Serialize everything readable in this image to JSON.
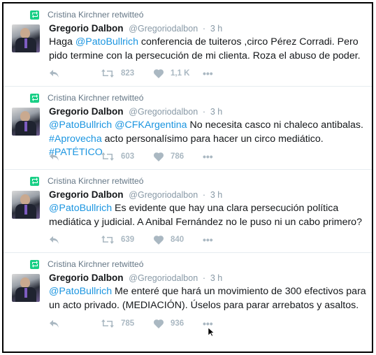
{
  "retweeter": "Cristina Kirchner retwitteó",
  "author": {
    "name": "Gregorio Dalbon",
    "handle": "@Gregoriodalbon",
    "separator": "·"
  },
  "tweets": [
    {
      "time": "3 h",
      "segments": [
        {
          "t": "Haga "
        },
        {
          "t": "@PatoBullrich",
          "link": true
        },
        {
          "t": " conferencia de tuiteros ,circo Pérez Corradi. Pero pido termine con la persecución de mi clienta. Roza el abuso de poder."
        }
      ],
      "retweets": "823",
      "likes": "1,1 K"
    },
    {
      "time": "3 h",
      "segments": [
        {
          "t": "@PatoBullrich",
          "link": true
        },
        {
          "t": " "
        },
        {
          "t": "@CFKArgentina",
          "link": true
        },
        {
          "t": " No necesita casco ni chaleco antibalas. "
        },
        {
          "t": "#Aprovecha",
          "link": true
        },
        {
          "t": " acto personalísimo para hacer un circo mediático. "
        },
        {
          "t": "#PATÉTICO",
          "link": true,
          "break_before": true
        }
      ],
      "retweets": "603",
      "likes": "786"
    },
    {
      "time": "3 h",
      "segments": [
        {
          "t": "@PatoBullrich",
          "link": true
        },
        {
          "t": " Es evidente que hay una clara persecución política mediática y judicial. A Anibal Fernández no le puso ni un cabo primero?"
        }
      ],
      "retweets": "639",
      "likes": "840"
    },
    {
      "time": "3 h",
      "segments": [
        {
          "t": "@PatoBullrich",
          "link": true
        },
        {
          "t": " Me enteré que hará un movimiento de 300 efectivos para un acto privado. (MEDIACIÓN). Úselos para parar arrebatos y asaltos."
        }
      ],
      "retweets": "785",
      "likes": "936"
    }
  ],
  "more_label": "•••",
  "colors": {
    "link": "#1b95e0",
    "retweet_badge": "#19cf86",
    "muted": "#aab8c2"
  },
  "icons": [
    "retweet-badge-icon",
    "reply-icon",
    "retweet-icon",
    "heart-icon",
    "more-icon"
  ]
}
